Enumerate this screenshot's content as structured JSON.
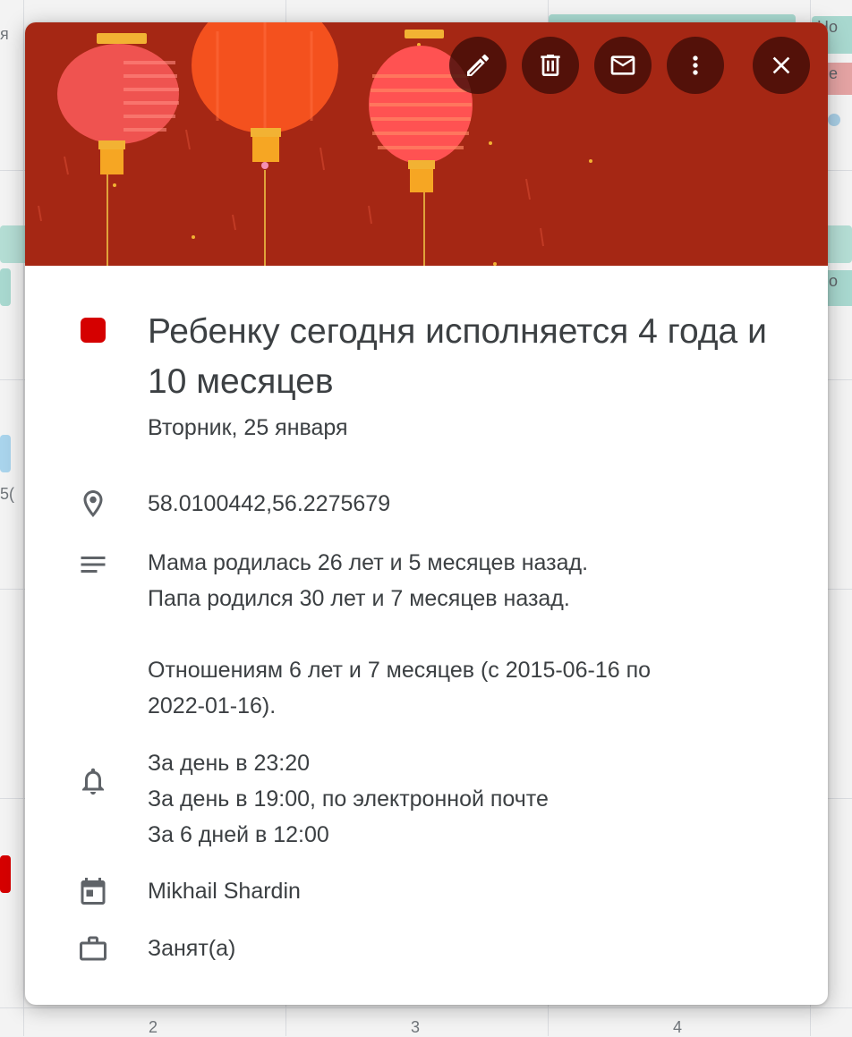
{
  "colors": {
    "event_color": "#d50000",
    "header_bg": "#a52714",
    "action_button_bg": "#3c0c06"
  },
  "actions": [
    {
      "name": "edit-button",
      "icon": "pencil-icon",
      "label": "Edit"
    },
    {
      "name": "delete-button",
      "icon": "trash-icon",
      "label": "Delete"
    },
    {
      "name": "email-button",
      "icon": "mail-icon",
      "label": "Email guests"
    },
    {
      "name": "more-options-button",
      "icon": "more-vert-icon",
      "label": "Options"
    },
    {
      "name": "close-button",
      "icon": "close-icon",
      "label": "Close"
    }
  ],
  "event": {
    "title": "Ребенку сегодня исполняется 4 года и 10 месяцев",
    "date": "Вторник, 25 января",
    "location": "58.0100442,56.2275679",
    "description_lines": [
      "Мама родилась 26 лет и 5 месяцев назад.",
      "Папа родился 30 лет и 7 месяцев назад.",
      "",
      "Отношениям 6 лет и 7 месяцев (с 2015-06-16 по",
      "2022-01-16)."
    ],
    "reminders": [
      "За день в 23:20",
      "За день в 19:00, по электронной почте",
      "За 6 дней в 12:00"
    ],
    "calendar": "Mikhail Shardin",
    "availability": "Занят(а)"
  },
  "background": {
    "chip_labels": [
      "Но",
      "Ne",
      "Но"
    ],
    "edge_text": [
      "я",
      "5("
    ],
    "day_numbers": [
      "2",
      "3",
      "4"
    ]
  }
}
